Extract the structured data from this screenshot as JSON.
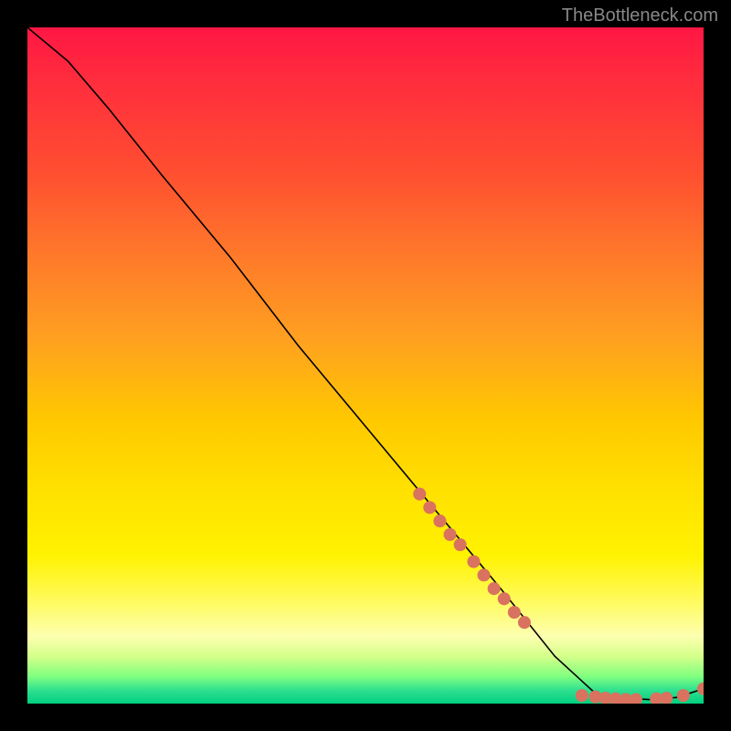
{
  "watermark": "TheBottleneck.com",
  "chart_data": {
    "type": "line",
    "title": "",
    "xlabel": "",
    "ylabel": "",
    "xlim": [
      0,
      100
    ],
    "ylim": [
      0,
      100
    ],
    "curve": [
      {
        "x": 0,
        "y": 100
      },
      {
        "x": 6,
        "y": 95
      },
      {
        "x": 12,
        "y": 88
      },
      {
        "x": 20,
        "y": 78
      },
      {
        "x": 30,
        "y": 66
      },
      {
        "x": 40,
        "y": 53
      },
      {
        "x": 50,
        "y": 41
      },
      {
        "x": 60,
        "y": 29
      },
      {
        "x": 70,
        "y": 17
      },
      {
        "x": 78,
        "y": 7
      },
      {
        "x": 84,
        "y": 1.5
      },
      {
        "x": 88,
        "y": 0.8
      },
      {
        "x": 92,
        "y": 0.6
      },
      {
        "x": 96,
        "y": 0.9
      },
      {
        "x": 100,
        "y": 2.2
      }
    ],
    "markers": [
      {
        "x": 58,
        "y": 31
      },
      {
        "x": 59.5,
        "y": 29
      },
      {
        "x": 61,
        "y": 27
      },
      {
        "x": 62.5,
        "y": 25
      },
      {
        "x": 64,
        "y": 23.5
      },
      {
        "x": 66,
        "y": 21
      },
      {
        "x": 67.5,
        "y": 19
      },
      {
        "x": 69,
        "y": 17
      },
      {
        "x": 70.5,
        "y": 15.5
      },
      {
        "x": 72,
        "y": 13.5
      },
      {
        "x": 73.5,
        "y": 12
      },
      {
        "x": 82,
        "y": 1.2
      },
      {
        "x": 84,
        "y": 1.0
      },
      {
        "x": 85.5,
        "y": 0.8
      },
      {
        "x": 87,
        "y": 0.7
      },
      {
        "x": 88.5,
        "y": 0.6
      },
      {
        "x": 90,
        "y": 0.6
      },
      {
        "x": 93,
        "y": 0.7
      },
      {
        "x": 94.5,
        "y": 0.8
      },
      {
        "x": 97,
        "y": 1.2
      },
      {
        "x": 100,
        "y": 2.2
      }
    ],
    "marker_color": "#d9725e",
    "curve_color": "#000000"
  }
}
